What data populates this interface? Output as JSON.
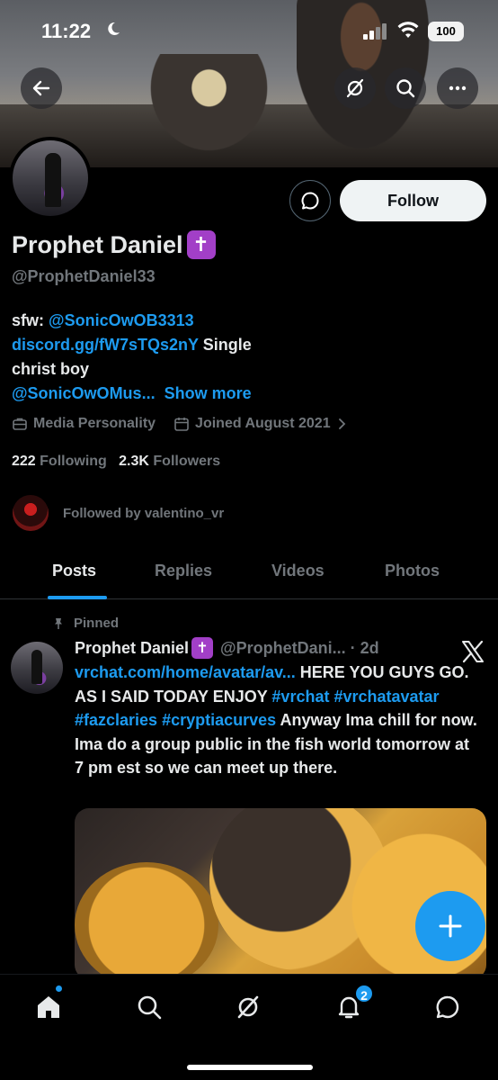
{
  "status_bar": {
    "time": "11:22",
    "battery": "100"
  },
  "profile": {
    "display_name": "Prophet Daniel",
    "badge_glyph": "✝",
    "handle": "@ProphetDaniel33",
    "follow_label": "Follow",
    "bio": {
      "line1_prefix": "sfw: ",
      "line1_link": "@SonicOwOB3313",
      "line2_link": "discord.gg/fW7sTQs2nY",
      "line2_suffix": " Single",
      "line3": "christ boy",
      "line4_link": "@SonicOwOMus...",
      "show_more": "Show more"
    },
    "category": "Media Personality",
    "joined": "Joined August 2021",
    "following_count": "222",
    "following_label": "Following",
    "followers_count": "2.3K",
    "followers_label": "Followers",
    "followed_by": "Followed by valentino_vr"
  },
  "tabs": [
    {
      "label": "Posts",
      "active": true
    },
    {
      "label": "Replies",
      "active": false
    },
    {
      "label": "Videos",
      "active": false
    },
    {
      "label": "Photos",
      "active": false
    }
  ],
  "post": {
    "pinned_label": "Pinned",
    "author": "Prophet Daniel",
    "handle_time": "@ProphetDani... · 2d",
    "link": "vrchat.com/home/avatar/av...",
    "text_a": " HERE YOU GUYS GO. AS I SAID TODAY ENJOY ",
    "tag1": "#vrchat",
    "tag2": "#vrchatavatar",
    "tag3": "#fazclaries",
    "tag4": "#cryptiacurves",
    "text_b": " Anyway Ima chill for now. Ima do a group public in the fish world tomorrow at 7 pm est so we can meet up there."
  },
  "bottom_nav": {
    "notification_count": "2",
    "items": [
      "home-icon",
      "search-icon",
      "grok-icon",
      "notifications-icon",
      "messages-icon"
    ]
  },
  "colors": {
    "accent": "#1d9bf0",
    "badge": "#a23fc7",
    "muted": "#71767b",
    "text": "#e7e9ea"
  }
}
